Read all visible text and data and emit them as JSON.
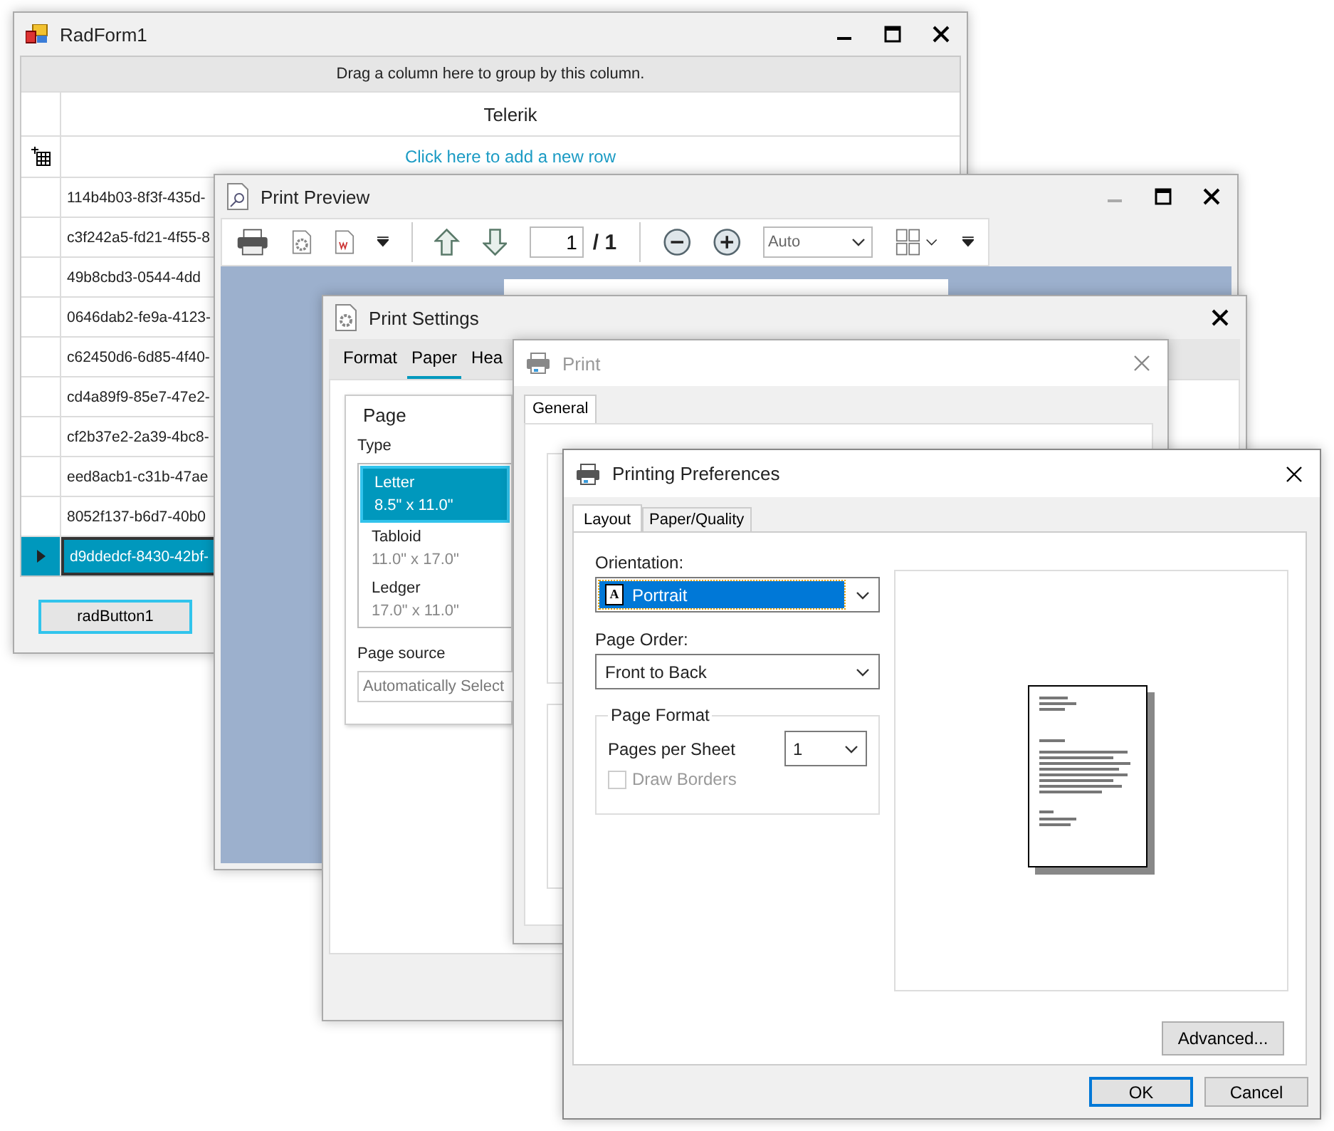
{
  "grid_window": {
    "title": "RadForm1",
    "group_panel": "Drag a column here to group by this column.",
    "column_header": "Telerik",
    "new_row": "Click here to add a new row",
    "button": "radButton1",
    "rows": [
      {
        "value": "114b4b03-8f3f-435d-",
        "selected": false
      },
      {
        "value": "c3f242a5-fd21-4f55-8",
        "selected": false
      },
      {
        "value": "49b8cbd3-0544-4dd",
        "selected": false
      },
      {
        "value": "0646dab2-fe9a-4123-",
        "selected": false
      },
      {
        "value": "c62450d6-6d85-4f40-",
        "selected": false
      },
      {
        "value": "cd4a89f9-85e7-47e2-",
        "selected": false
      },
      {
        "value": "cf2b37e2-2a39-4bc8-",
        "selected": false
      },
      {
        "value": "eed8acb1-c31b-47ae",
        "selected": false
      },
      {
        "value": "8052f137-b6d7-40b0",
        "selected": false
      },
      {
        "value": "d9ddedcf-8430-42bf-",
        "selected": true
      }
    ]
  },
  "preview_window": {
    "title": "Print Preview",
    "page_field": "1",
    "page_total": "/ 1",
    "zoom": "Auto"
  },
  "settings_window": {
    "title": "Print Settings",
    "tabs": [
      {
        "label": "Format",
        "selected": false
      },
      {
        "label": "Paper",
        "selected": true
      },
      {
        "label": "Hea",
        "selected": false
      }
    ],
    "group_title": "Page",
    "type_label": "Type",
    "paper_types": [
      {
        "name": "Letter",
        "size": "8.5\" x 11.0\"",
        "selected": true
      },
      {
        "name": "Tabloid",
        "size": "11.0\" x 17.0\"",
        "selected": false
      },
      {
        "name": "Ledger",
        "size": "17.0\" x 11.0\"",
        "selected": false
      }
    ],
    "source_label": "Page source",
    "source_value": "Automatically Select"
  },
  "print_window": {
    "title": "Print",
    "active": false,
    "tabs": [
      {
        "label": "General",
        "selected": true
      }
    ]
  },
  "preferences_window": {
    "title": "Printing Preferences",
    "tabs": [
      {
        "label": "Layout",
        "selected": true
      },
      {
        "label": "Paper/Quality",
        "selected": false
      }
    ],
    "orientation_label": "Orientation:",
    "orientation_icon_letter": "A",
    "orientation": "Portrait",
    "page_order_label": "Page Order:",
    "page_order": "Front to Back",
    "page_format_title": "Page Format",
    "pages_per_sheet_label": "Pages per Sheet",
    "pages_per_sheet": "1",
    "draw_borders": {
      "label": "Draw Borders",
      "checked": false,
      "disabled": true
    },
    "buttons": [
      {
        "label": "Advanced...",
        "default": false
      },
      {
        "label": "OK",
        "default": true
      },
      {
        "label": "Cancel",
        "default": false
      }
    ]
  }
}
